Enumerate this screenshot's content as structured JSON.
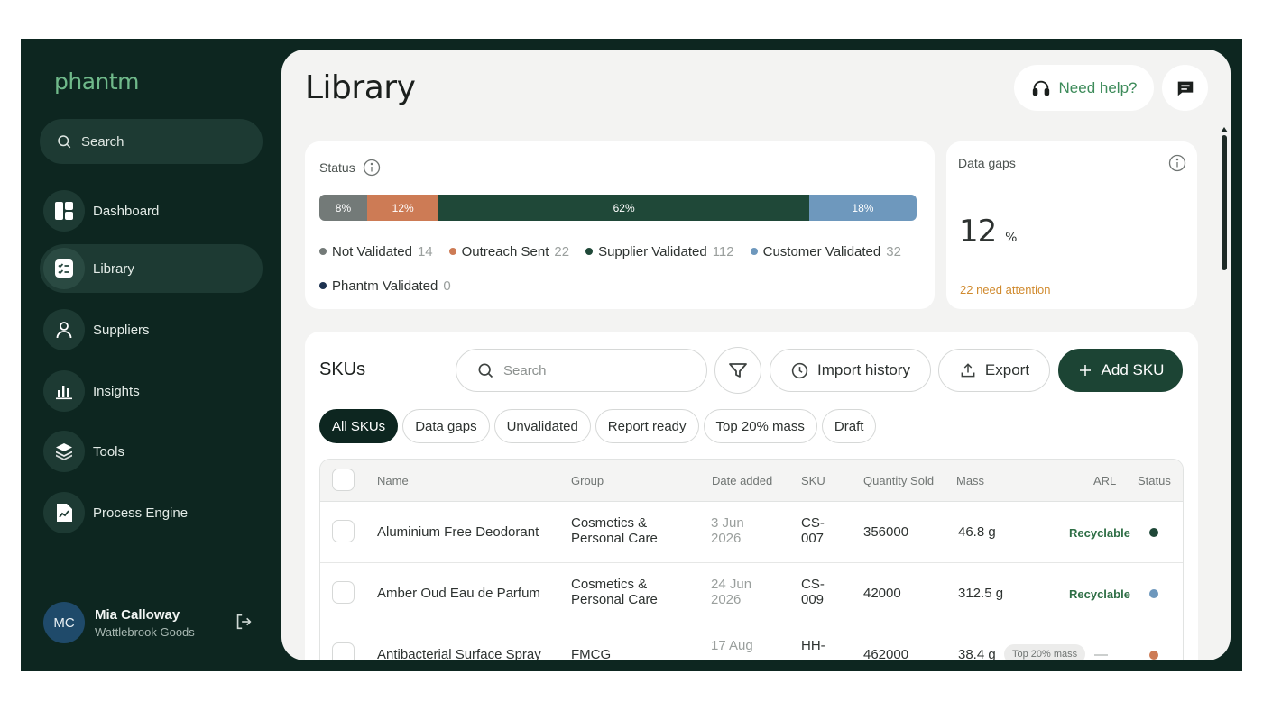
{
  "sidebar": {
    "logo": "phantm",
    "search_label": "Search",
    "items": [
      {
        "label": "Dashboard",
        "icon": "dashboard-icon"
      },
      {
        "label": "Library",
        "icon": "checklist-icon",
        "active": true
      },
      {
        "label": "Suppliers",
        "icon": "user-icon"
      },
      {
        "label": "Insights",
        "icon": "bar-chart-icon"
      },
      {
        "label": "Tools",
        "icon": "layers-icon"
      },
      {
        "label": "Process Engine",
        "icon": "document-chart-icon"
      }
    ],
    "user": {
      "initials": "MC",
      "name": "Mia Calloway",
      "org": "Wattlebrook Goods"
    }
  },
  "header": {
    "title": "Library",
    "help_label": "Need help?"
  },
  "status": {
    "label": "Status",
    "segments": [
      {
        "pct": "8%",
        "value": 8,
        "color": "#737a78"
      },
      {
        "pct": "12%",
        "value": 12,
        "color": "#cd7b55"
      },
      {
        "pct": "62%",
        "value": 62,
        "color": "#1f4838"
      },
      {
        "pct": "18%",
        "value": 18,
        "color": "#6e98bd"
      }
    ],
    "legend": [
      {
        "name": "Not Validated",
        "count": "14",
        "color": "#737a78"
      },
      {
        "name": "Outreach Sent",
        "count": "22",
        "color": "#cd7b55"
      },
      {
        "name": "Supplier Validated",
        "count": "112",
        "color": "#1f4838"
      },
      {
        "name": "Customer Validated",
        "count": "32",
        "color": "#6e98bd"
      },
      {
        "name": "Phantm Validated",
        "count": "0",
        "color": "#1d3250"
      }
    ]
  },
  "data_gaps": {
    "label": "Data gaps",
    "value": "12",
    "unit": "%",
    "attention": "22 need attention"
  },
  "skus": {
    "title": "SKUs",
    "search_placeholder": "Search",
    "import_label": "Import history",
    "export_label": "Export",
    "add_label": "Add SKU",
    "chips": [
      "All SKUs",
      "Data gaps",
      "Unvalidated",
      "Report ready",
      "Top 20% mass",
      "Draft"
    ],
    "columns": [
      "Name",
      "Group",
      "Date added",
      "SKU",
      "Quantity Sold",
      "Mass",
      "ARL",
      "Status"
    ],
    "rows": [
      {
        "name": "Aluminium Free Deodorant",
        "group_1": "Cosmetics &",
        "group_2": "Personal Care",
        "date_1": "3 Jun",
        "date_2": "2026",
        "sku_1": "CS-",
        "sku_2": "007",
        "qty": "356000",
        "mass": "46.8 g",
        "tag": "",
        "arl": "Recyclable",
        "status_color": "#1f4838"
      },
      {
        "name": "Amber Oud Eau de Parfum",
        "group_1": "Cosmetics &",
        "group_2": "Personal Care",
        "date_1": "24 Jun",
        "date_2": "2026",
        "sku_1": "CS-",
        "sku_2": "009",
        "qty": "42000",
        "mass": "312.5 g",
        "tag": "",
        "arl": "Recyclable",
        "status_color": "#6e98bd"
      },
      {
        "name": "Antibacterial Surface Spray",
        "group_1": "FMCG",
        "group_2": "",
        "date_1": "17 Aug",
        "date_2": "",
        "sku_1": "HH-",
        "sku_2": "",
        "qty": "462000",
        "mass": "38.4 g",
        "tag": "Top 20% mass",
        "arl": "—",
        "status_color": "#cd7b55"
      }
    ]
  }
}
